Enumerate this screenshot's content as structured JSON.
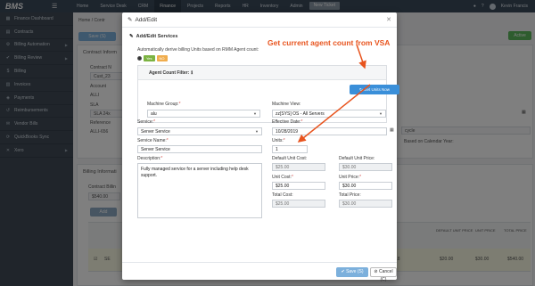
{
  "app": {
    "logo": "BMS"
  },
  "topnav": [
    "Home",
    "Service Desk",
    "CRM",
    "Finance",
    "Projects",
    "Reports",
    "HR",
    "Inventory",
    "Admin"
  ],
  "topnav_active": "Finance",
  "new_ticket": "New Ticket",
  "user_name": "Kevin Francis",
  "sidebar": {
    "items": [
      {
        "label": "Finance Dashboard",
        "icon": "dashboard-icon"
      },
      {
        "label": "Contracts",
        "icon": "contract-icon"
      },
      {
        "label": "Billing Automation",
        "icon": "automation-icon"
      },
      {
        "label": "Billing Review",
        "icon": "review-icon"
      },
      {
        "label": "Billing",
        "icon": "billing-icon"
      },
      {
        "label": "Invoices",
        "icon": "invoice-icon"
      },
      {
        "label": "Payments",
        "icon": "payment-icon"
      },
      {
        "label": "Reimbursements",
        "icon": "reimburse-icon"
      },
      {
        "label": "Vendor Bills",
        "icon": "vendor-icon"
      },
      {
        "label": "QuickBooks Sync",
        "icon": "sync-icon"
      },
      {
        "label": "Xero",
        "icon": "xero-icon"
      }
    ]
  },
  "background": {
    "home_label": "Home",
    "save_label": "Save (S)",
    "active_badge": "Active",
    "contract_info": "Contract Inform",
    "contract_no_label": "Contract N",
    "contract_no_value": "Cust_23",
    "account_label": "Account",
    "account_value": "ALLI",
    "sla_label": "SLA",
    "sla_value": "SLA 24x",
    "reference_label": "Reference",
    "reference_value": "ALLI-656",
    "cycle_value": "cycle",
    "based_on": "Based on Calendar Year:",
    "billing_info": "Billing Informati",
    "contract_billing": "Contract Billin",
    "contract_billing_value": "$540.00",
    "add_label": "Add",
    "table_headers": [
      "DEFAULT UNIT PRICE",
      "UNIT PRICE",
      "TOTAL PRICE"
    ],
    "row_values": [
      "$20.00",
      "$30.00",
      "$540.00"
    ],
    "row_code": "SE",
    "row_units": "18"
  },
  "modal": {
    "title": "Add/Edit",
    "section": "Add/Edit Services",
    "auto_derive": "Automatically derive billing Units based on RMM Agent count:",
    "yes": "Yes",
    "no": "NO",
    "filter_title": "Agent Count Filter:",
    "get_units": "Get Units Now",
    "machine_group_label": "Machine Group:",
    "machine_group_value": "alu",
    "machine_view_label": "Machine View:",
    "machine_view_value": "zz[SYS] OS - All Servers",
    "service_label": "Service:",
    "service_value": "Server Service",
    "effective_date_label": "Effective Date:",
    "effective_date_value": "10/28/2019",
    "service_name_label": "Service Name:",
    "service_name_value": "Server Service",
    "units_label": "Units:",
    "units_value": "1",
    "description_label": "Description:",
    "description_value": "Fully managed service for a server including help desk support.",
    "default_unit_cost_label": "Default Unit Cost:",
    "default_unit_cost_value": "$25.00",
    "default_unit_price_label": "Default Unit Price:",
    "default_unit_price_value": "$30.00",
    "unit_cost_label": "Unit Cost:",
    "unit_cost_value": "$25.00",
    "unit_price_label": "Unit Price:",
    "unit_price_value": "$30.00",
    "total_cost_label": "Total Cost:",
    "total_cost_value": "$25.00",
    "total_price_label": "Total Price:",
    "total_price_value": "$30.00",
    "save": "Save (S)",
    "cancel": "Cancel (C)"
  },
  "annotation": "Get current agent count from VSA",
  "colors": {
    "annotation": "#e8541e",
    "primary": "#3a8fd9",
    "sidebar": "#404b57",
    "topbar": "#3b4a5a"
  }
}
